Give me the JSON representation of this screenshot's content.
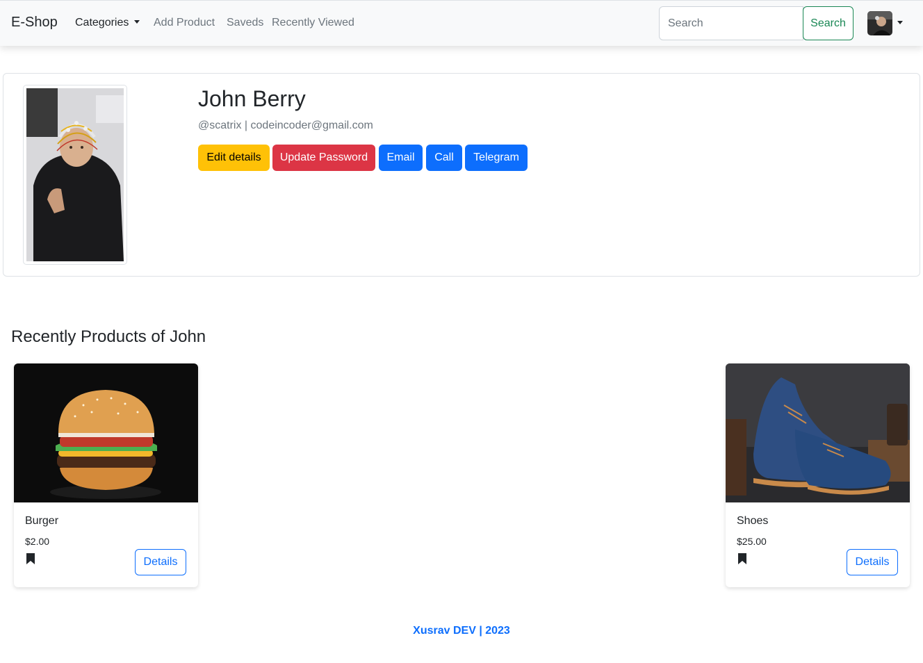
{
  "navbar": {
    "brand": "E-Shop",
    "links": {
      "categories": "Categories",
      "add_product": "Add Product",
      "saveds": "Saveds",
      "recently_viewed": "Recently Viewed"
    },
    "search": {
      "placeholder": "Search",
      "button_label": "Search"
    }
  },
  "profile": {
    "name": "John Berry",
    "username": "@scatrix",
    "separator": "|",
    "email": "codeincoder@gmail.com",
    "buttons": {
      "edit": "Edit details",
      "update_password": "Update Password",
      "email": "Email",
      "call": "Call",
      "telegram": "Telegram"
    }
  },
  "section": {
    "title": "Recently Products of John"
  },
  "products": [
    {
      "name": "Burger",
      "price": "$2.00",
      "details_label": "Details"
    },
    {
      "name": "Shoes",
      "price": "$25.00",
      "details_label": "Details"
    }
  ],
  "footer": {
    "text": "Xusrav DEV | 2023"
  },
  "colors": {
    "primary": "#0d6efd",
    "warning": "#ffc107",
    "danger": "#dc3545",
    "success": "#198754"
  },
  "icons": [
    "chevron-down-icon",
    "bookmark-icon",
    "avatar"
  ]
}
